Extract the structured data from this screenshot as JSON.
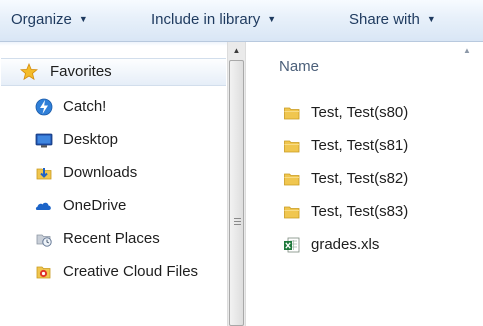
{
  "toolbar": {
    "organize_label": "Organize",
    "include_label": "Include in library",
    "share_label": "Share with",
    "dropdown_caret": "▼"
  },
  "navigation": {
    "favorites_label": "Favorites",
    "items": [
      {
        "label": "Catch!",
        "icon": "catch-icon"
      },
      {
        "label": "Desktop",
        "icon": "desktop-icon"
      },
      {
        "label": "Downloads",
        "icon": "downloads-icon"
      },
      {
        "label": "OneDrive",
        "icon": "onedrive-icon"
      },
      {
        "label": "Recent Places",
        "icon": "recent-places-icon"
      },
      {
        "label": "Creative Cloud Files",
        "icon": "creative-cloud-icon"
      }
    ]
  },
  "file_list": {
    "column_name": "Name",
    "items": [
      {
        "name": "Test, Test(s80)",
        "type": "folder",
        "icon": "folder-icon"
      },
      {
        "name": "Test, Test(s81)",
        "type": "folder",
        "icon": "folder-icon"
      },
      {
        "name": "Test, Test(s82)",
        "type": "folder",
        "icon": "folder-icon"
      },
      {
        "name": "Test, Test(s83)",
        "type": "folder",
        "icon": "folder-icon"
      },
      {
        "name": "grades.xls",
        "type": "excel-file",
        "icon": "excel-file-icon"
      }
    ]
  },
  "colors": {
    "toolbar_gradient_top": "#f7fbff",
    "toolbar_gradient_bottom": "#d9e6f5",
    "toolbar_text": "#1e3a5f",
    "column_header_text": "#4c607a",
    "folder_yellow": "#f0c64f",
    "excel_green": "#1f7a3c"
  }
}
